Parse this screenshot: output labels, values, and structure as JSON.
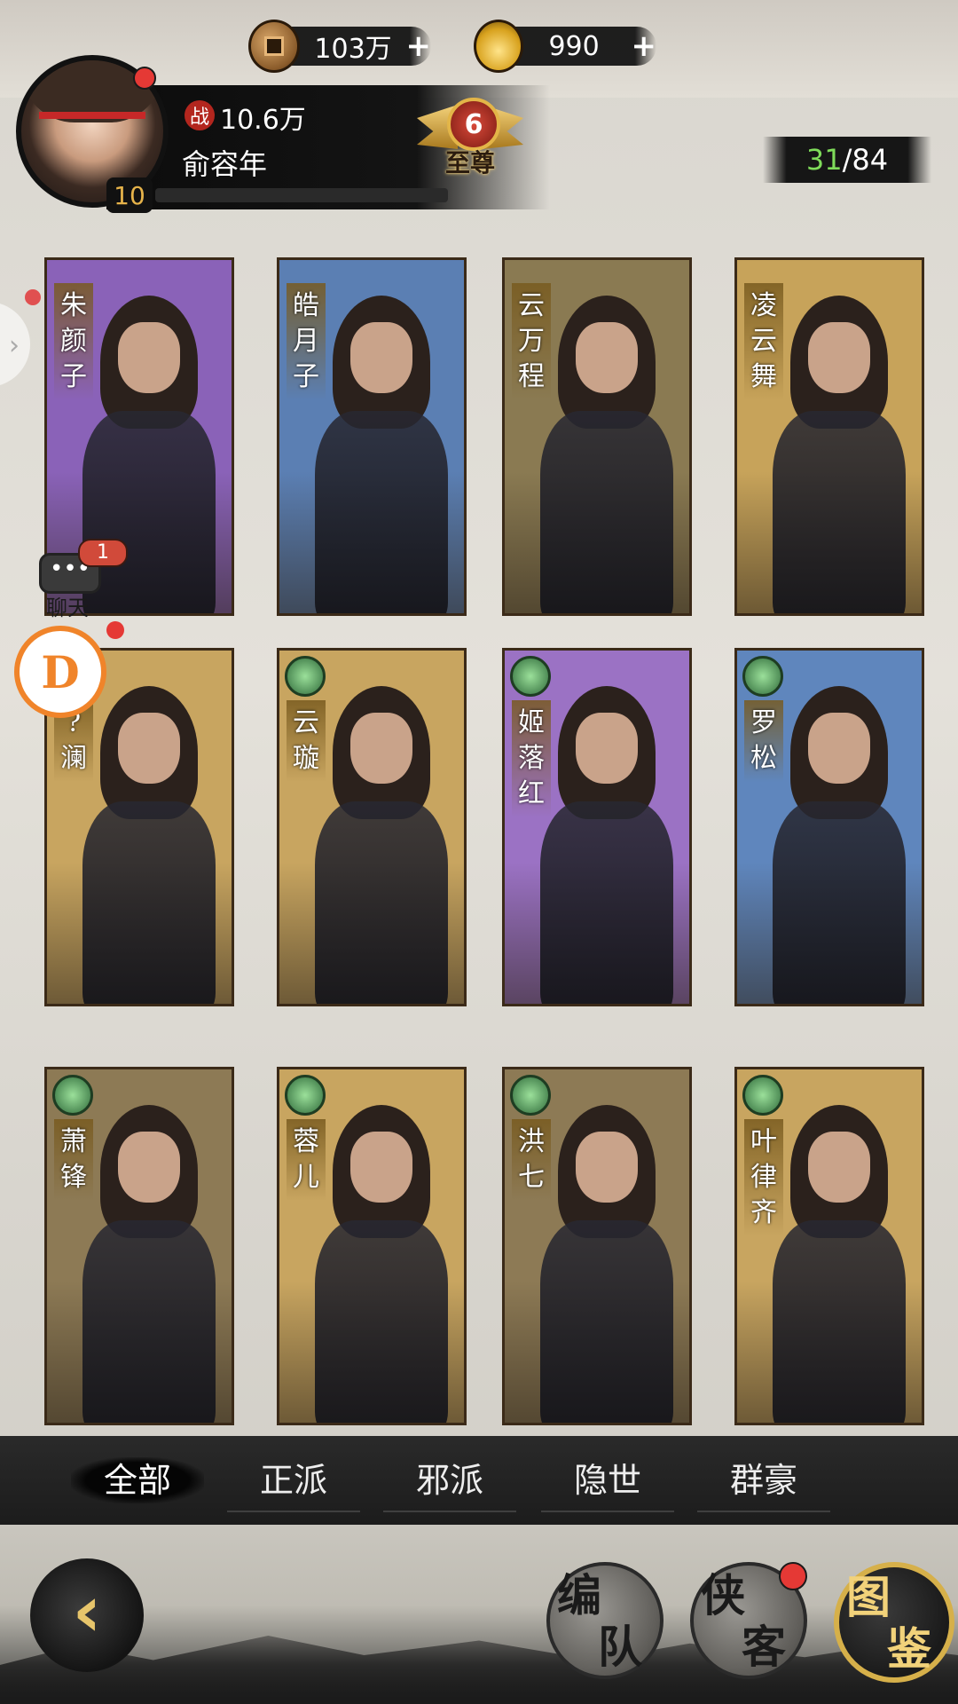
{
  "currency": {
    "copper": {
      "icon": "copper-coin-icon",
      "value": "103万",
      "plus": "+"
    },
    "gold": {
      "icon": "gold-ingot-icon",
      "value": "990",
      "plus": "+"
    }
  },
  "player": {
    "power_icon_text": "战",
    "power": "10.6万",
    "name": "俞容年",
    "level": "10",
    "rank_number": "6",
    "rank_label": "至尊"
  },
  "hero_count": {
    "owned": "31",
    "separator": "/",
    "total": "84"
  },
  "heroes": [
    {
      "name": "朱颜子",
      "chars": [
        "朱",
        "颜",
        "子"
      ],
      "color": "#8a62b8"
    },
    {
      "name": "皓月子",
      "chars": [
        "皓",
        "月",
        "子"
      ],
      "color": "#5b7fb3"
    },
    {
      "name": "云万程",
      "chars": [
        "云",
        "万",
        "程"
      ],
      "color": "#8a7a52"
    },
    {
      "name": "凌云舞",
      "chars": [
        "凌",
        "云",
        "舞"
      ],
      "color": "#c7a35a"
    },
    {
      "name": "?澜",
      "chars": [
        "?",
        "澜"
      ],
      "color": "#c8a560"
    },
    {
      "name": "云璇",
      "chars": [
        "云",
        "璇"
      ],
      "color": "#c8a560"
    },
    {
      "name": "姬落红",
      "chars": [
        "姬",
        "落",
        "红"
      ],
      "color": "#9b72c4"
    },
    {
      "name": "罗松",
      "chars": [
        "罗",
        "松"
      ],
      "color": "#5f86bd"
    },
    {
      "name": "萧锋",
      "chars": [
        "萧",
        "锋"
      ],
      "color": "#8d7a55"
    },
    {
      "name": "蓉儿",
      "chars": [
        "蓉",
        "儿"
      ],
      "color": "#c8a560"
    },
    {
      "name": "洪七",
      "chars": [
        "洪",
        "七"
      ],
      "color": "#8d7a55"
    },
    {
      "name": "叶律齐",
      "chars": [
        "叶",
        "律",
        "齐"
      ],
      "color": "#c8a560"
    }
  ],
  "chat": {
    "dots": "•••",
    "count": "1",
    "label": "聊天"
  },
  "float_ball_letter": "D",
  "tabs": [
    {
      "label": "全部",
      "active": true
    },
    {
      "label": "正派",
      "active": false
    },
    {
      "label": "邪派",
      "active": false
    },
    {
      "label": "隐世",
      "active": false
    },
    {
      "label": "群豪",
      "active": false
    }
  ],
  "nav": {
    "back_icon": "‹",
    "formation": {
      "c1": "编",
      "c2": "队"
    },
    "heroes": {
      "c1": "侠",
      "c2": "客"
    },
    "codex": {
      "c1": "图",
      "c2": "鉴"
    }
  }
}
